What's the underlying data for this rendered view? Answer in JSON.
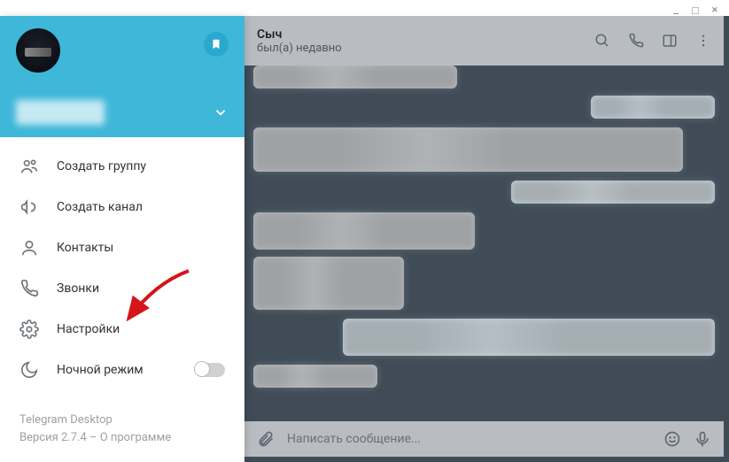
{
  "window": {
    "minimize": "_",
    "maximize": "□",
    "close": "×"
  },
  "chat": {
    "title": "Сыч",
    "status": "был(а) недавно",
    "composer_placeholder": "Написать сообщение..."
  },
  "drawer": {
    "menu": {
      "new_group": "Создать группу",
      "new_channel": "Создать канал",
      "contacts": "Контакты",
      "calls": "Звонки",
      "settings": "Настройки",
      "night_mode": "Ночной режим"
    },
    "footer": {
      "app_name": "Telegram Desktop",
      "version_line": "Версия 2.7.4 – О программе"
    }
  }
}
